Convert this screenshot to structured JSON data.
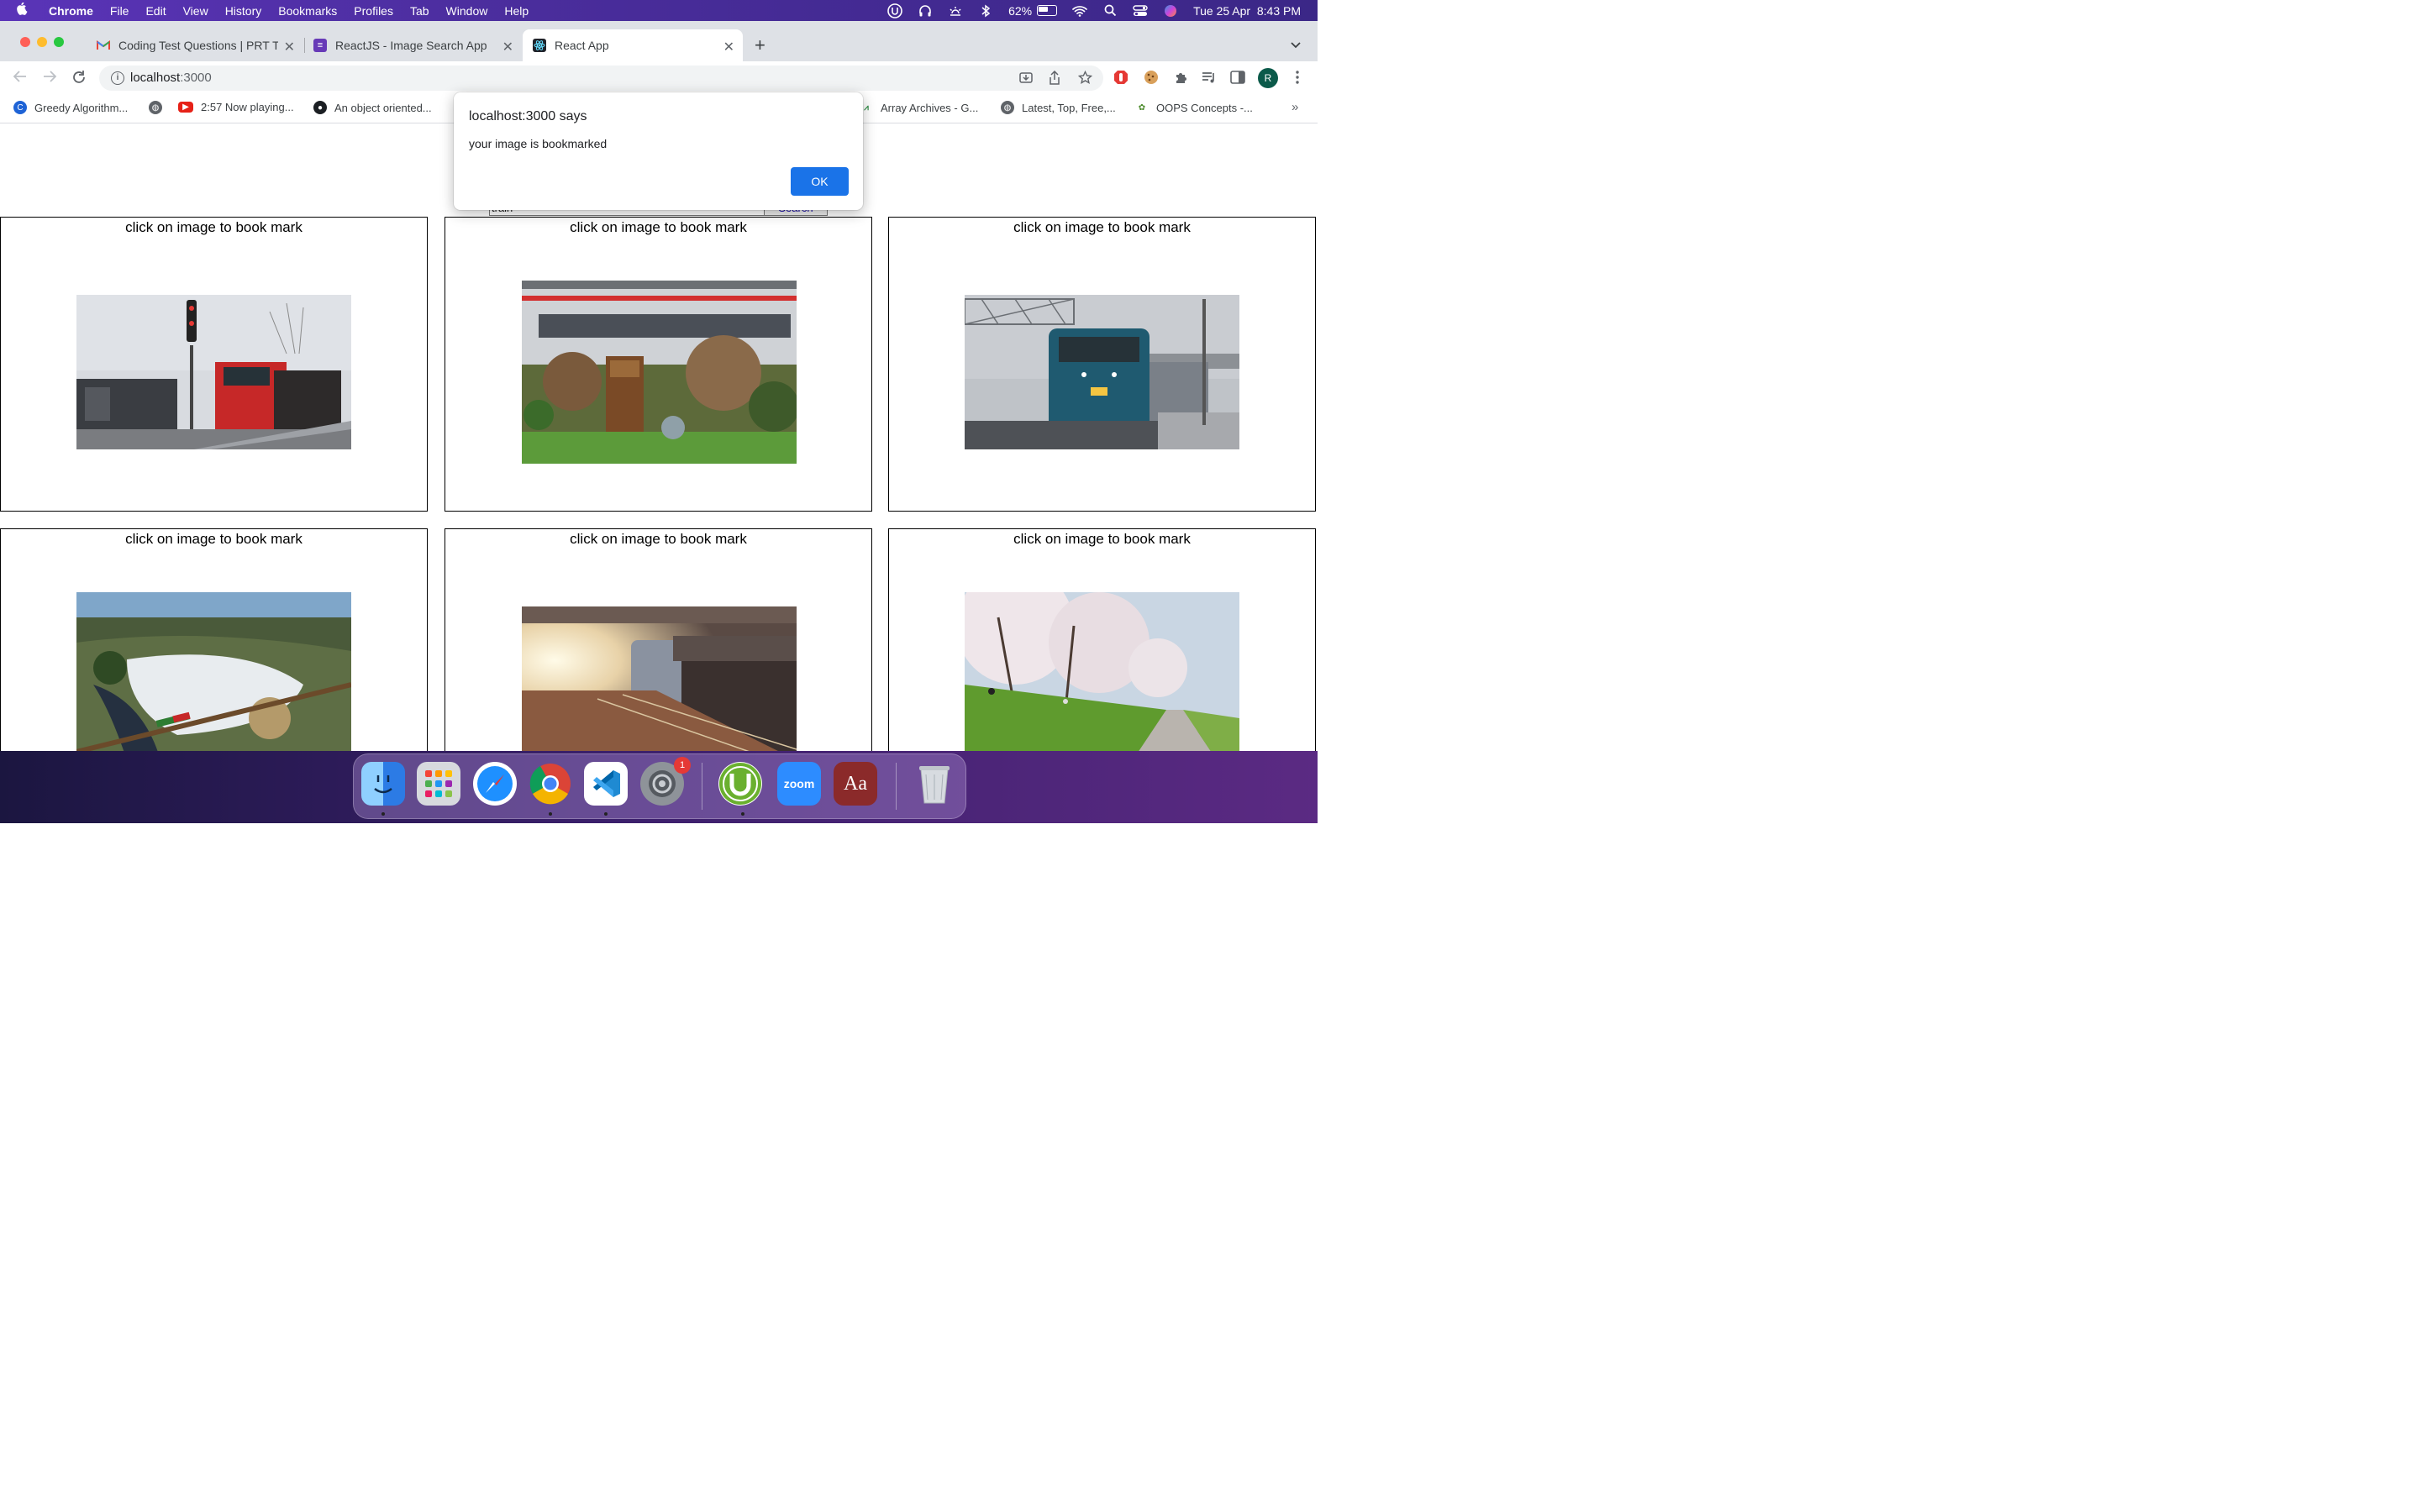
{
  "menubar": {
    "app": "Chrome",
    "items": [
      "File",
      "Edit",
      "View",
      "History",
      "Bookmarks",
      "Profiles",
      "Tab",
      "Window",
      "Help"
    ],
    "battery": "62%",
    "datetime": "Tue 25 Apr  8:43 PM"
  },
  "tabs": [
    {
      "title": "Coding Test Questions | PRT Te",
      "icon": "gmail-icon"
    },
    {
      "title": "ReactJS - Image Search App",
      "icon": "forms-icon"
    },
    {
      "title": "React App",
      "icon": "react-icon"
    }
  ],
  "address": {
    "host": "localhost",
    "port": ":3000"
  },
  "bookmarks": [
    {
      "title": "Greedy Algorithm...",
      "icon": "globe-c-icon"
    },
    {
      "title": "",
      "icon": "globe-icon"
    },
    {
      "title": "2:57 Now playing...",
      "icon": "youtube-icon"
    },
    {
      "title": "An object oriented...",
      "icon": "github-icon"
    },
    {
      "title": "Array Archives - G...",
      "icon": "gfg-icon"
    },
    {
      "title": "Latest, Top, Free,...",
      "icon": "globe-icon"
    },
    {
      "title": "OOPS Concepts -...",
      "icon": "palm-icon"
    }
  ],
  "page": {
    "search_value": "train",
    "search_button": "Search",
    "cards": [
      {
        "caption": "click on image to book mark"
      },
      {
        "caption": "click on image to book mark"
      },
      {
        "caption": "click on image to book mark"
      },
      {
        "caption": "click on image to book mark"
      },
      {
        "caption": "click on image to book mark"
      },
      {
        "caption": "click on image to book mark"
      }
    ]
  },
  "dialog": {
    "title": "localhost:3000 says",
    "message": "your image is bookmarked",
    "ok_label": "OK"
  },
  "dock": {
    "apps": [
      "Finder",
      "Launchpad",
      "Safari",
      "Chrome",
      "VS Code",
      "System Settings",
      "uTorrent",
      "Zoom",
      "Dictionary",
      "Trash"
    ],
    "zoom_label": "zoom",
    "dictionary_label": "Aa",
    "settings_badge": "1"
  },
  "colors": {
    "accent": "#1a73e8",
    "menubar": "#4a2d9c"
  }
}
